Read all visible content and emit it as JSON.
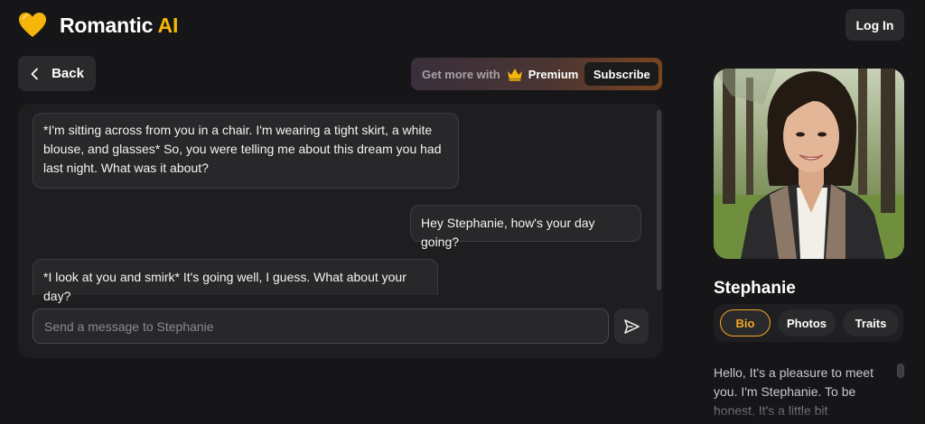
{
  "header": {
    "brand_main": "Romantic ",
    "brand_accent": "AI",
    "login_label": "Log In"
  },
  "nav": {
    "back_label": "Back"
  },
  "premium": {
    "get_more": "Get more with",
    "premium_label": "Premium",
    "subscribe_label": "Subscribe"
  },
  "chat": {
    "messages": [
      {
        "sender": "Stephanie",
        "text": "*I'm sitting across from you in a chair. I'm wearing a tight skirt, a white blouse, and glasses* So, you were telling me about this dream you had last night. What was it about?"
      },
      {
        "sender": "user",
        "text": "Hey Stephanie, how's your day going?"
      },
      {
        "sender": "Stephanie",
        "text": "*I look at you and smirk* It's going well, I guess. What about your day?"
      }
    ],
    "input_placeholder": "Send a message to Stephanie",
    "input_value": ""
  },
  "profile": {
    "name": "Stephanie",
    "tabs": [
      "Bio",
      "Photos",
      "Traits"
    ],
    "active_tab": "Bio",
    "bio": "Hello, It's a pleasure to meet you. I'm Stephanie. To be honest, It's a little bit"
  },
  "colors": {
    "accent": "#f5b50a",
    "tab_active": "#f5a623",
    "background": "#161618",
    "panel": "#1e1e20"
  }
}
